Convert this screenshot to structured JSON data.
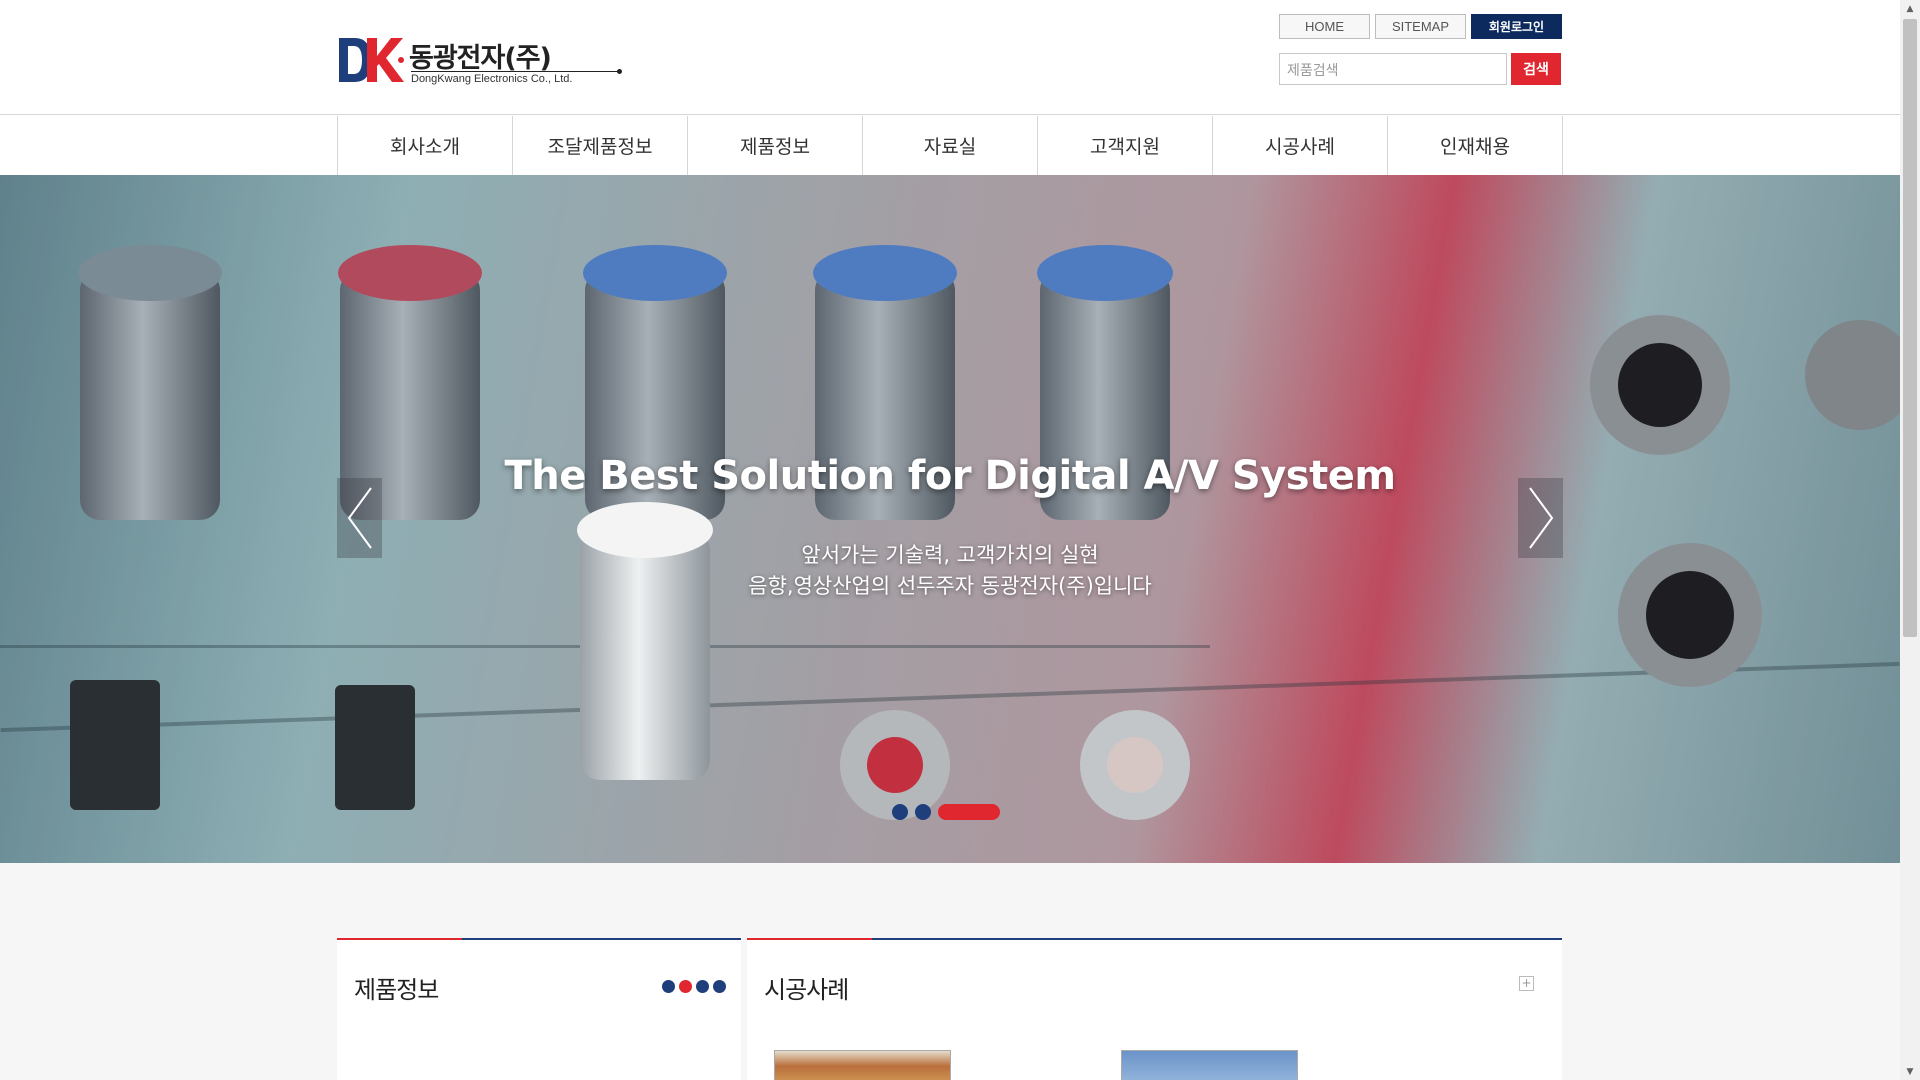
{
  "header": {
    "logo_text_ko": "동광전자(주)",
    "logo_text_en": "DongKwang Electronics Co., Ltd.",
    "logo_mark": "DK"
  },
  "util": {
    "home": "HOME",
    "sitemap": "SITEMAP",
    "login": "회원로그인"
  },
  "search": {
    "placeholder": "제품검색",
    "button": "검색"
  },
  "nav": {
    "items": [
      "회사소개",
      "조달제품정보",
      "제품정보",
      "자료실",
      "고객지원",
      "시공사례",
      "인재채용"
    ]
  },
  "hero": {
    "title": "The Best Solution for Digital A/V System",
    "subtitle_line1": "앞서가는 기술력, 고객가치의 실현",
    "subtitle_line2": "음향,영상산업의 선두주자 동광전자(주)입니다",
    "slides_count": 3,
    "active_slide": 3
  },
  "panels": {
    "products_title": "제품정보",
    "cases_title": "시공사례"
  },
  "colors": {
    "navy": "#1f3e7c",
    "red": "#e0262e",
    "login_bg": "#0c2a5e"
  }
}
